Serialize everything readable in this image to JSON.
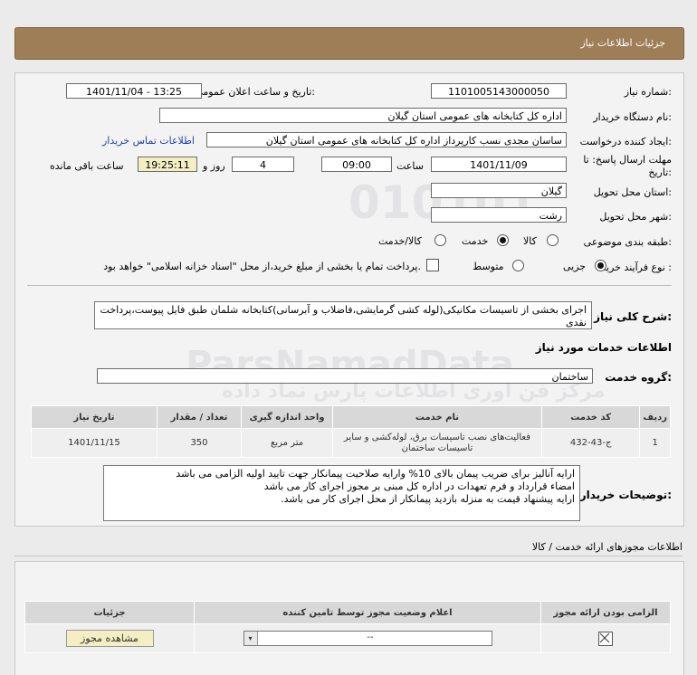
{
  "header": {
    "title": "جزئیات اطلاعات نیاز"
  },
  "watermark": {
    "line1": "010101",
    "line2": "ParsNamadData",
    "line3": "مرکز فن آوری اطلاعات پارس نماد داده"
  },
  "fields": {
    "need_number_label": "شماره نیاز:",
    "need_number": "1101005143000050",
    "announce_label": "تاریخ و ساعت اعلان عمومی:",
    "announce_value": "1401/11/04 - 13:25",
    "buyer_org_label": "نام دستگاه خریدار:",
    "buyer_org": "اداره کل کتابخانه های عمومی استان گیلان",
    "creator_label": "ایجاد کننده درخواست:",
    "creator": "ساسان مجدی نسب کارپرداز اداره کل کتابخانه های عمومی استان گیلان",
    "contact_link": "اطلاعات تماس خریدار",
    "deadline_label_1": "مهلت ارسال پاسخ: تا",
    "deadline_label_2": "تاریخ:",
    "deadline_date": "1401/11/09",
    "time_label": "ساعت",
    "deadline_time": "09:00",
    "days_value": "4",
    "days_label": "روز و",
    "remaining_time": "19:25:11",
    "remaining_label": "ساعت باقی مانده",
    "province_label": "استان محل تحویل:",
    "province": "گیلان",
    "city_label": "شهر محل تحویل:",
    "city": "رشت",
    "category_label": "طبقه بندی موضوعی:",
    "cat_goods": "کالا",
    "cat_service": "خدمت",
    "cat_goods_service": "کالا/خدمت",
    "process_label": "نوع فرآیند خرید :",
    "proc_partial": "جزیی",
    "proc_medium": "متوسط",
    "payment_note": "پرداخت تمام یا بخشی از مبلغ خرید،از محل \"اسناد خزانه اسلامی\" خواهد بود."
  },
  "summary": {
    "label": "شرح کلی نیاز:",
    "text": "اجرای بخشی از تاسیسات مکانیکی(لوله کشی گرمایشی،فاضلاب و آبرسانی)کتابخانه شلمان طبق فایل پیوست،پرداخت نقدی"
  },
  "services": {
    "section_title": "اطلاعات خدمات مورد نیاز",
    "group_label": "گروه خدمت:",
    "group_value": "ساختمان",
    "columns": [
      "ردیف",
      "کد خدمت",
      "نام خدمت",
      "واحد اندازه گیری",
      "تعداد / مقدار",
      "تاریخ نیاز"
    ],
    "rows": [
      {
        "row": "1",
        "code": "ج-43-432",
        "name": "فعالیت‌های نصب تاسیسات برق، لوله‌کشی و سایر تاسیسات ساختمان",
        "unit": "متر مربع",
        "qty": "350",
        "date": "1401/11/15"
      }
    ]
  },
  "buyer_notes": {
    "label": "توضیحات خریدار:",
    "line1": "ارایه آنالیز برای ضریب پیمان بالای 10% وارایه صلاحیت پیمانکار جهت تایید اولیه الزامی می باشد",
    "line2": "امضاء قرارداد و فرم تعهدات در اداره کل مبنی بر مجوز اجرای کار می باشد",
    "line3": "ارایه پیشنهاد قیمت به منزله بازدید پیمانکار از محل اجرای کار می باشد."
  },
  "permits": {
    "section_title": "اطلاعات مجوزهای ارائه خدمت / کالا",
    "columns": [
      "الزامی بودن ارائه مجوز",
      "اعلام وضعیت مجوز توسط تامین کننده",
      "جزئیات"
    ],
    "select_value": "--",
    "view_button": "مشاهده مجوز"
  }
}
